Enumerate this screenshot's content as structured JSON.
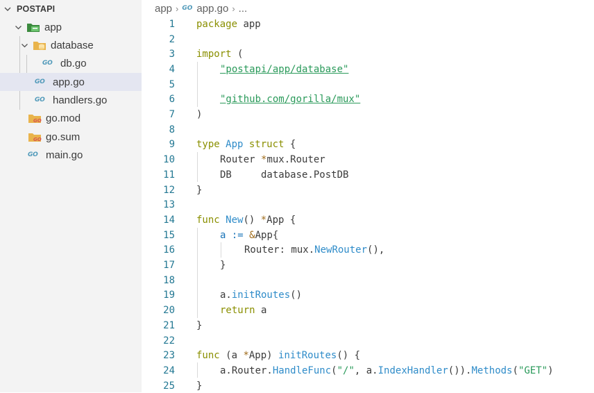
{
  "explorer": {
    "section_title": "POSTAPI",
    "items": [
      {
        "label": "app",
        "type": "folder-open"
      },
      {
        "label": "database",
        "type": "folder-open"
      },
      {
        "label": "db.go",
        "type": "go-file"
      },
      {
        "label": "app.go",
        "type": "go-file",
        "selected": true
      },
      {
        "label": "handlers.go",
        "type": "go-file"
      },
      {
        "label": "go.mod",
        "type": "go-mod-file"
      },
      {
        "label": "go.sum",
        "type": "go-mod-file"
      },
      {
        "label": "main.go",
        "type": "go-file"
      }
    ]
  },
  "breadcrumb": {
    "folder": "app",
    "file": "app.go",
    "tail": "...",
    "file_icon": "GO"
  },
  "editor": {
    "line_numbers": [
      "1",
      "2",
      "3",
      "4",
      "5",
      "6",
      "7",
      "8",
      "9",
      "10",
      "11",
      "12",
      "13",
      "14",
      "15",
      "16",
      "17",
      "18",
      "19",
      "20",
      "21",
      "22",
      "23",
      "24",
      "25"
    ],
    "tokens": {
      "l1a": "package",
      "l1b": " app",
      "l3a": "import",
      "l3b": " (",
      "l4a": "\"postapi/app/database\"",
      "l6a": "\"github.com/gorilla/mux\"",
      "l7a": ")",
      "l9a": "type",
      "l9b": " App",
      "l9c": " struct",
      "l9d": " {",
      "l10a": "Router ",
      "l10b": "*",
      "l10c": "mux.Router",
      "l11a": "DB     database.PostDB",
      "l12a": "}",
      "l14a": "func",
      "l14b": " New",
      "l14c": "() ",
      "l14d": "*",
      "l14e": "App {",
      "l15a": "a",
      "l15b": " := ",
      "l15c": "&",
      "l15d": "App{",
      "l16a": "Router: mux.",
      "l16b": "NewRouter",
      "l16c": "(),",
      "l17a": "}",
      "l19a": "a.",
      "l19b": "initRoutes",
      "l19c": "()",
      "l20a": "return",
      "l20b": " a",
      "l21a": "}",
      "l23a": "func",
      "l23b": " (a ",
      "l23c": "*",
      "l23d": "App) ",
      "l23e": "initRoutes",
      "l23f": "() {",
      "l24a": "a.Router.",
      "l24b": "HandleFunc",
      "l24c": "(",
      "l24d": "\"/\"",
      "l24e": ", a.",
      "l24f": "IndexHandler",
      "l24g": "()).",
      "l24h": "Methods",
      "l24i": "(",
      "l24j": "\"GET\"",
      "l24k": ")",
      "l25a": "}"
    }
  },
  "colors": {
    "sidebar_bg": "#f3f3f3",
    "selected_bg": "#e4e6f1",
    "line_number": "#237893",
    "keyword": "#8a8f00",
    "type": "#2f8cc9",
    "string": "#2a9a5a",
    "go_icon": "#519aba"
  }
}
